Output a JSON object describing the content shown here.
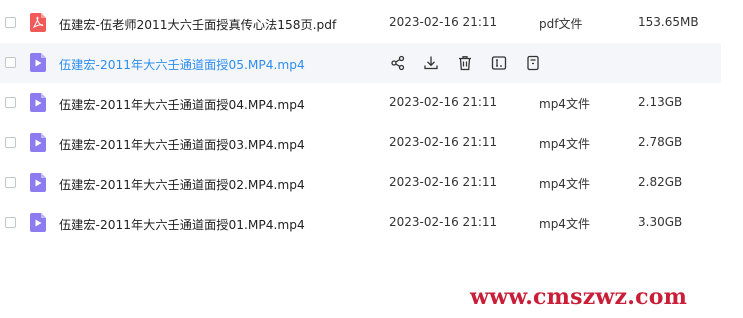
{
  "files": [
    {
      "name": "伍建宏-伍老师2011大六壬面授真传心法158页.pdf",
      "date": "2023-02-16 21:11",
      "type": "pdf文件",
      "size": "153.65MB",
      "icon": "pdf-icon",
      "hover": false
    },
    {
      "name": "伍建宏-2011年大六壬通道面授05.MP4.mp4",
      "date": "",
      "type": "",
      "size": "",
      "icon": "video-icon",
      "hover": true
    },
    {
      "name": "伍建宏-2011年大六壬通道面授04.MP4.mp4",
      "date": "2023-02-16 21:11",
      "type": "mp4文件",
      "size": "2.13GB",
      "icon": "video-icon",
      "hover": false
    },
    {
      "name": "伍建宏-2011年大六壬通道面授03.MP4.mp4",
      "date": "2023-02-16 21:11",
      "type": "mp4文件",
      "size": "2.78GB",
      "icon": "video-icon",
      "hover": false
    },
    {
      "name": "伍建宏-2011年大六壬通道面授02.MP4.mp4",
      "date": "2023-02-16 21:11",
      "type": "mp4文件",
      "size": "2.82GB",
      "icon": "video-icon",
      "hover": false
    },
    {
      "name": "伍建宏-2011年大六壬通道面授01.MP4.mp4",
      "date": "2023-02-16 21:11",
      "type": "mp4文件",
      "size": "3.30GB",
      "icon": "video-icon",
      "hover": false
    }
  ],
  "row_actions": [
    {
      "icon": "share-icon"
    },
    {
      "icon": "download-icon"
    },
    {
      "icon": "delete-icon"
    },
    {
      "icon": "rename-icon"
    },
    {
      "icon": "more-icon"
    }
  ],
  "colors": {
    "pdf_icon": "#f25a5a",
    "video_icon": "#8c7cf0",
    "link_hover": "#2c8ef0",
    "watermark": "#c91e37"
  },
  "watermark": "www.cmszwz.com"
}
